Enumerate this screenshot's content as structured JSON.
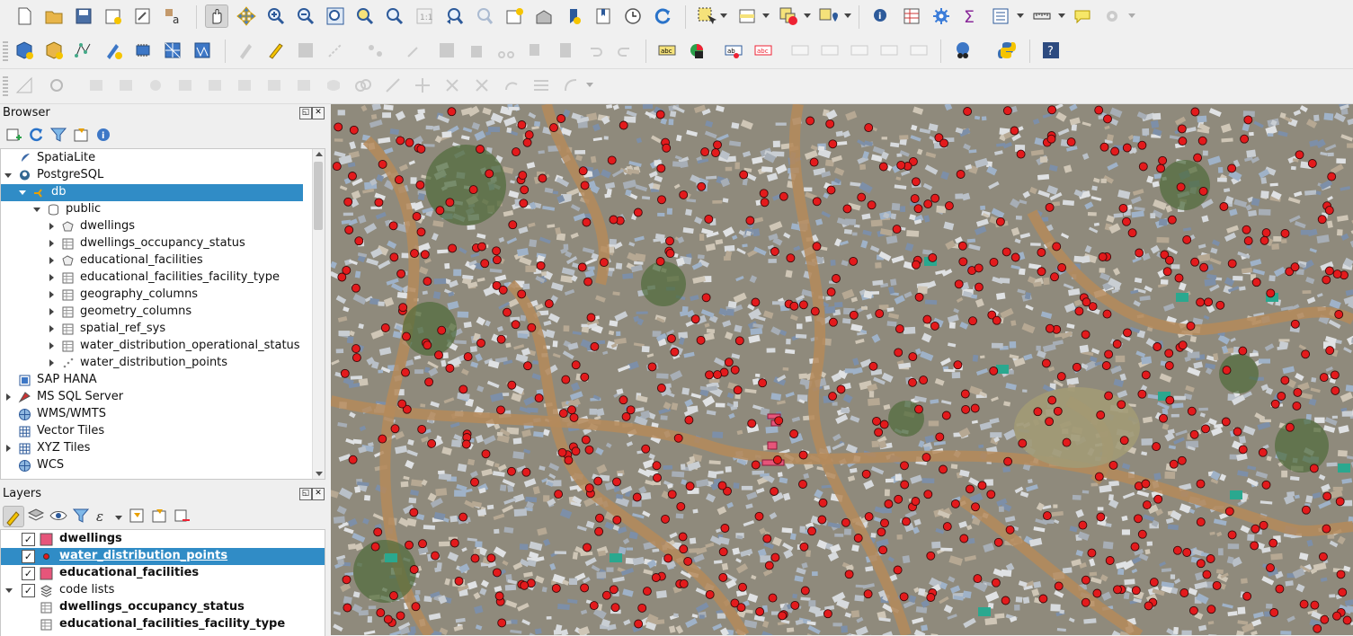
{
  "toolbars": {
    "row1": [
      "new-project",
      "open-project",
      "save-project",
      "new-print-layout",
      "layout-manager",
      "style-manager",
      "pan-map",
      "pan-to-selection",
      "zoom-in",
      "zoom-out",
      "zoom-full",
      "zoom-to-selection",
      "zoom-to-layer",
      "zoom-native",
      "zoom-last",
      "zoom-next",
      "new-bookmark",
      "show-bookmarks",
      "new-spatial-bookmark",
      "map-tips",
      "temporal-controller",
      "refresh",
      "select-features",
      "select-by-attribute",
      "deselect-all",
      "select-location",
      "identify",
      "attribute-table",
      "toolbox",
      "statistical-summary",
      "open-field-calculator",
      "measure",
      "annotations",
      "settings"
    ],
    "row2": [
      "data-source-manager",
      "new-geopackage",
      "new-shapefile",
      "new-scratch-layer",
      "new-virtual-layer",
      "new-mesh",
      "new-gps",
      "edits",
      "toggle-editing",
      "save-edits",
      "digitize",
      "vertex-tool",
      "delete-selected",
      "cut",
      "copy",
      "paste",
      "undo",
      "redo",
      "label-tool",
      "diagram",
      "pin-labels",
      "highlight-labels",
      "move-label",
      "rotate-label",
      "change-label",
      "plugin-globe",
      "python-console",
      "help"
    ]
  },
  "browser": {
    "title": "Browser",
    "items": [
      {
        "label": "SpatiaLite",
        "level": 0,
        "arrow": "",
        "icon": "feather"
      },
      {
        "label": "PostgreSQL",
        "level": 0,
        "arrow": "down",
        "icon": "elephant"
      },
      {
        "label": "db",
        "level": 1,
        "arrow": "down",
        "icon": "conn",
        "selected": true
      },
      {
        "label": "public",
        "level": 2,
        "arrow": "down",
        "icon": "schema"
      },
      {
        "label": "dwellings",
        "level": 3,
        "arrow": "right",
        "icon": "polygon"
      },
      {
        "label": "dwellings_occupancy_status",
        "level": 3,
        "arrow": "right",
        "icon": "table"
      },
      {
        "label": "educational_facilities",
        "level": 3,
        "arrow": "right",
        "icon": "polygon"
      },
      {
        "label": "educational_facilities_facility_type",
        "level": 3,
        "arrow": "right",
        "icon": "table"
      },
      {
        "label": "geography_columns",
        "level": 3,
        "arrow": "right",
        "icon": "table"
      },
      {
        "label": "geometry_columns",
        "level": 3,
        "arrow": "right",
        "icon": "table"
      },
      {
        "label": "spatial_ref_sys",
        "level": 3,
        "arrow": "right",
        "icon": "table"
      },
      {
        "label": "water_distribution_operational_status",
        "level": 3,
        "arrow": "right",
        "icon": "table"
      },
      {
        "label": "water_distribution_points",
        "level": 3,
        "arrow": "right",
        "icon": "points"
      },
      {
        "label": "SAP HANA",
        "level": 0,
        "arrow": "",
        "icon": "hana"
      },
      {
        "label": "MS SQL Server",
        "level": 0,
        "arrow": "right",
        "icon": "mssql"
      },
      {
        "label": "WMS/WMTS",
        "level": 0,
        "arrow": "",
        "icon": "globe"
      },
      {
        "label": "Vector Tiles",
        "level": 0,
        "arrow": "",
        "icon": "grid"
      },
      {
        "label": "XYZ Tiles",
        "level": 0,
        "arrow": "right",
        "icon": "grid"
      },
      {
        "label": "WCS",
        "level": 0,
        "arrow": "",
        "icon": "globe"
      }
    ]
  },
  "layers": {
    "title": "Layers",
    "items": [
      {
        "label": "dwellings",
        "checked": true,
        "symbol": "fill",
        "level": 0,
        "bold": true
      },
      {
        "label": "water_distribution_points",
        "checked": true,
        "symbol": "point",
        "level": 0,
        "bold": true,
        "selected": true
      },
      {
        "label": "educational_facilities",
        "checked": true,
        "symbol": "fill",
        "level": 0,
        "bold": true
      },
      {
        "label": "code lists",
        "checked": true,
        "symbol": "group",
        "level": 0,
        "bold": false,
        "arrow": "down"
      },
      {
        "label": "dwellings_occupancy_status",
        "symbol": "table",
        "level": 1,
        "bold": true
      },
      {
        "label": "educational_facilities_facility_type",
        "symbol": "table",
        "level": 1,
        "bold": true
      }
    ]
  },
  "colors": {
    "selection": "#308cc6",
    "point": "#e31a1c",
    "polygon": "#e6557a"
  }
}
